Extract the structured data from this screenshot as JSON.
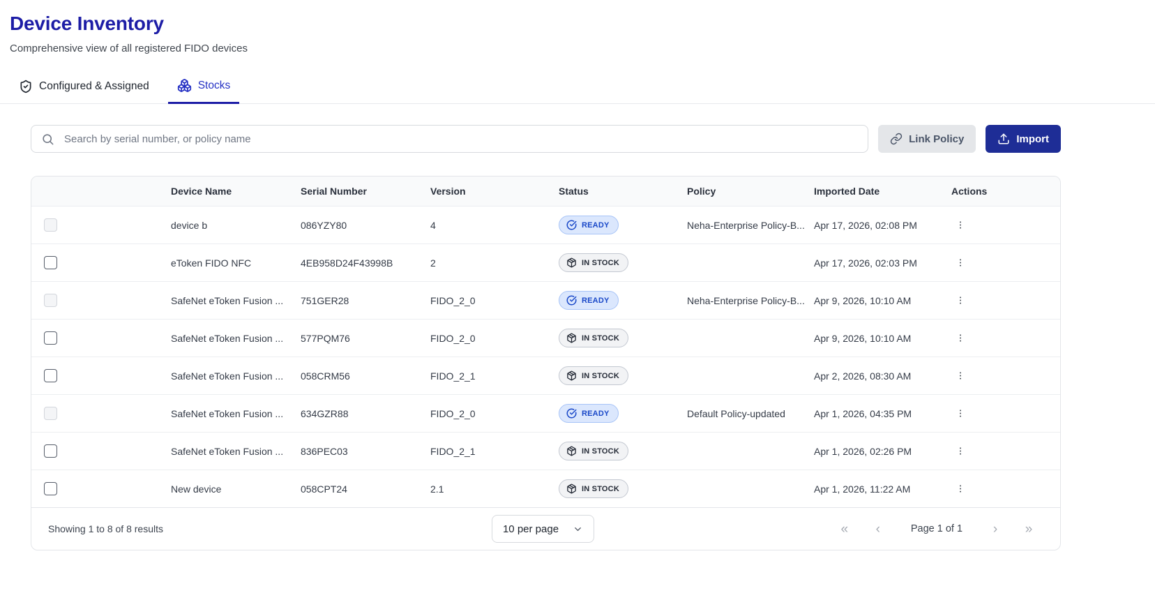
{
  "page": {
    "title": "Device Inventory",
    "subtitle": "Comprehensive view of all registered FIDO devices"
  },
  "tabs": [
    {
      "label": "Configured & Assigned",
      "icon": "shield-check-icon",
      "active": false
    },
    {
      "label": "Stocks",
      "icon": "boxes-icon",
      "active": true
    }
  ],
  "toolbar": {
    "search_placeholder": "Search by serial number, or policy name",
    "link_policy_label": "Link Policy",
    "import_label": "Import"
  },
  "table": {
    "columns": [
      "Device Name",
      "Serial Number",
      "Version",
      "Status",
      "Policy",
      "Imported Date",
      "Actions"
    ],
    "rows": [
      {
        "device_name": "device b",
        "serial_number": "086YZY80",
        "version": "4",
        "status": "READY",
        "policy": "Neha-Enterprise Policy-B...",
        "imported_date": "Apr 17, 2026, 02:08 PM",
        "checkbox_disabled": true
      },
      {
        "device_name": "eToken FIDO NFC",
        "serial_number": "4EB958D24F43998B",
        "version": "2",
        "status": "IN STOCK",
        "policy": "",
        "imported_date": "Apr 17, 2026, 02:03 PM",
        "checkbox_disabled": false
      },
      {
        "device_name": "SafeNet eToken Fusion ...",
        "serial_number": "751GER28",
        "version": "FIDO_2_0",
        "status": "READY",
        "policy": "Neha-Enterprise Policy-B...",
        "imported_date": "Apr 9, 2026, 10:10 AM",
        "checkbox_disabled": true
      },
      {
        "device_name": "SafeNet eToken Fusion ...",
        "serial_number": "577PQM76",
        "version": "FIDO_2_0",
        "status": "IN STOCK",
        "policy": "",
        "imported_date": "Apr 9, 2026, 10:10 AM",
        "checkbox_disabled": false
      },
      {
        "device_name": "SafeNet eToken Fusion ...",
        "serial_number": "058CRM56",
        "version": "FIDO_2_1",
        "status": "IN STOCK",
        "policy": "",
        "imported_date": "Apr 2, 2026, 08:30 AM",
        "checkbox_disabled": false
      },
      {
        "device_name": "SafeNet eToken Fusion ...",
        "serial_number": "634GZR88",
        "version": "FIDO_2_0",
        "status": "READY",
        "policy": "Default Policy-updated",
        "imported_date": "Apr 1, 2026, 04:35 PM",
        "checkbox_disabled": true
      },
      {
        "device_name": "SafeNet eToken Fusion ...",
        "serial_number": "836PEC03",
        "version": "FIDO_2_1",
        "status": "IN STOCK",
        "policy": "",
        "imported_date": "Apr 1, 2026, 02:26 PM",
        "checkbox_disabled": false
      },
      {
        "device_name": "New device",
        "serial_number": "058CPT24",
        "version": "2.1",
        "status": "IN STOCK",
        "policy": "",
        "imported_date": "Apr 1, 2026, 11:22 AM",
        "checkbox_disabled": false
      }
    ],
    "status_labels": {
      "ready": "READY",
      "instock": "IN STOCK"
    }
  },
  "footer": {
    "results_text": "Showing 1 to 8 of 8 results",
    "per_page_label": "10 per page",
    "page_label": "Page 1 of 1",
    "first_icon": "«",
    "prev_icon": "‹",
    "next_icon": "›",
    "last_icon": "»"
  },
  "colors": {
    "title_navy": "#1d1da6",
    "tab_active_blue": "#2531c4",
    "import_button_navy": "#1e2d96",
    "ready_badge_bg": "#dbe7fd",
    "ready_badge_text": "#1847c8",
    "instock_badge_bg": "#f2f3f5",
    "instock_badge_text": "#252b37"
  }
}
